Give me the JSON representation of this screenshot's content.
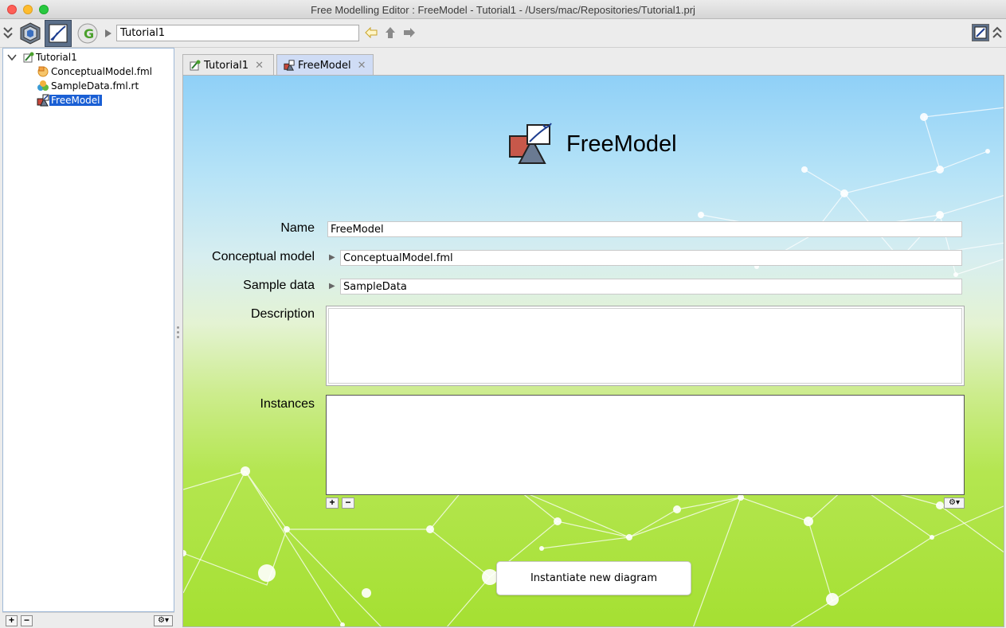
{
  "window": {
    "title": "Free Modelling Editor : FreeModel - Tutorial1 - /Users/mac/Repositories/Tutorial1.prj"
  },
  "toolbar": {
    "path_value": "Tutorial1",
    "icons": [
      "collapse-icon",
      "technology-cube-icon",
      "freemodel-editor-icon",
      "fml-module-icon",
      "back-arrow-icon",
      "up-arrow-icon",
      "forward-arrow-icon",
      "layout-icon",
      "expand-icon"
    ]
  },
  "tree": {
    "root": "Tutorial1",
    "items": [
      {
        "label": "ConceptualModel.fml",
        "icon": "conceptual-model-icon"
      },
      {
        "label": "SampleData.fml.rt",
        "icon": "sample-data-icon"
      },
      {
        "label": "FreeModel",
        "icon": "freemodel-icon",
        "selected": true
      }
    ]
  },
  "tabs": [
    {
      "label": "Tutorial1",
      "active": false
    },
    {
      "label": "FreeModel",
      "active": true
    }
  ],
  "main": {
    "title": "FreeModel",
    "fields": {
      "name_label": "Name",
      "name_value": "FreeModel",
      "conceptual_label": "Conceptual model",
      "conceptual_value": "ConceptualModel.fml",
      "sample_label": "Sample data",
      "sample_value": "SampleData",
      "description_label": "Description",
      "description_value": "",
      "instances_label": "Instances"
    },
    "add_symbol": "+",
    "remove_symbol": "−",
    "gear_symbol": "⚙▾",
    "instantiate_label": "Instantiate new diagram"
  },
  "colors": {
    "selection": "#1a5fd4",
    "active_tab": "#cfdcf5",
    "sky": "#8fd0f7",
    "grass": "#a5e032"
  }
}
